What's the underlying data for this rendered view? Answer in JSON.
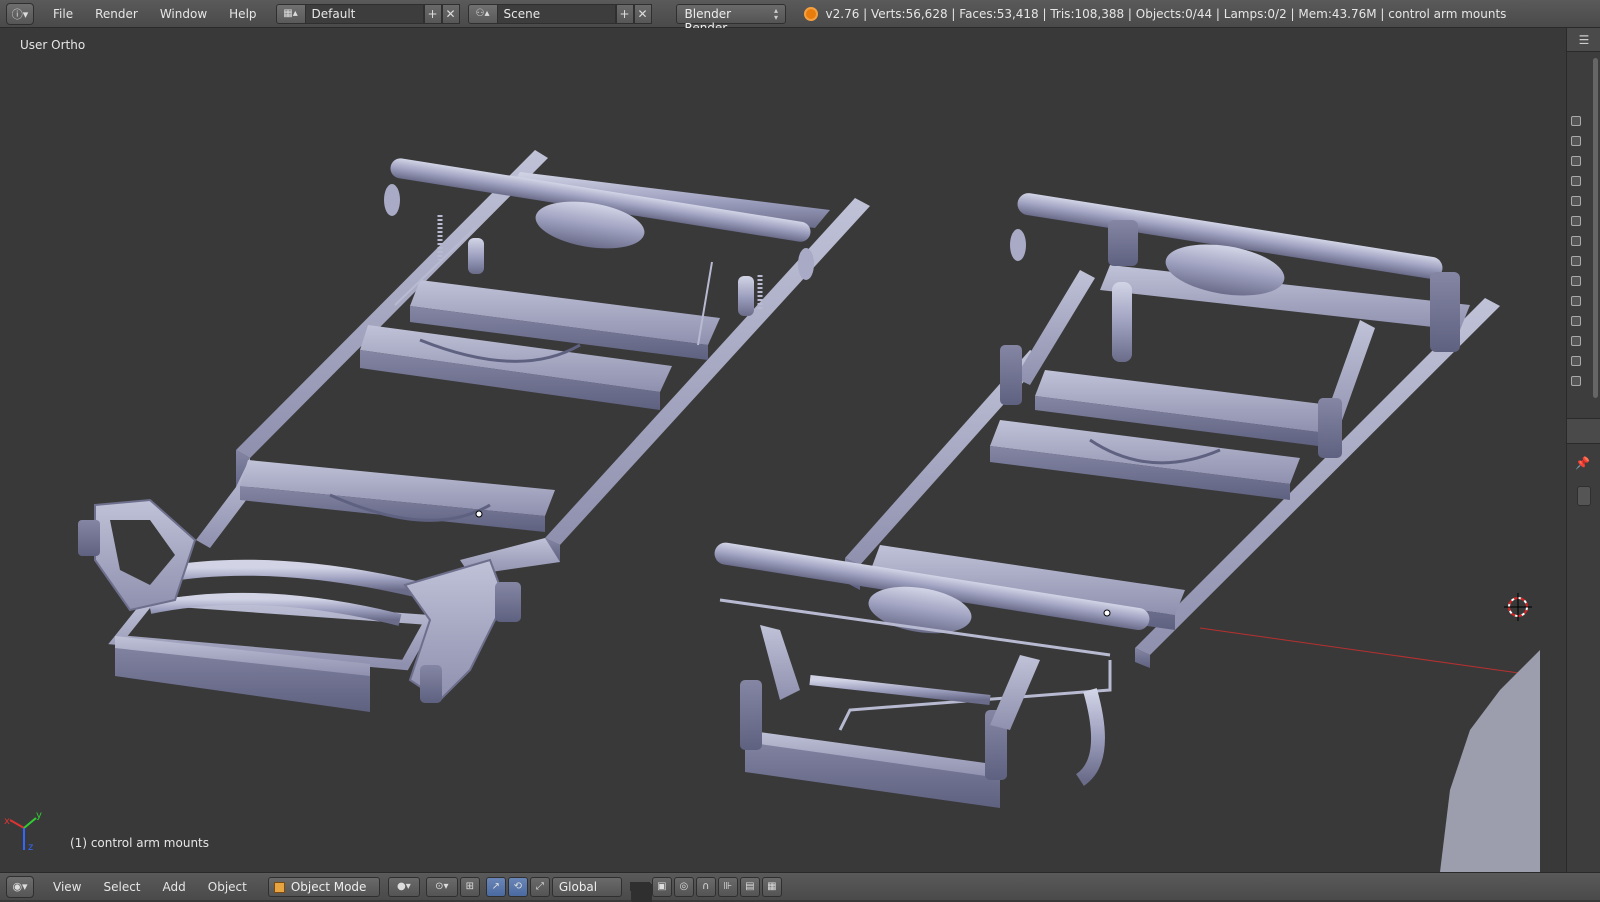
{
  "topbar": {
    "menus": [
      "File",
      "Render",
      "Window",
      "Help"
    ],
    "screen_layout": "Default",
    "scene": "Scene",
    "render_engine": "Blender Render",
    "stats": "v2.76 | Verts:56,628 | Faces:53,418 | Tris:108,388 | Objects:0/44 | Lamps:0/2 | Mem:43.76M | control arm mounts"
  },
  "viewport": {
    "view_name": "User Ortho",
    "object_label": "(1) control arm mounts",
    "axis_labels": {
      "x": "x",
      "y": "y",
      "z": "z"
    }
  },
  "bottombar": {
    "menus": [
      "View",
      "Select",
      "Add",
      "Object"
    ],
    "mode": "Object Mode",
    "orientation": "Global"
  },
  "colors": {
    "background": "#393939",
    "model": "#9a9cbc",
    "model_dark": "#6d6f8c",
    "model_light": "#c4c6dc",
    "axis_x": "#c23030"
  }
}
